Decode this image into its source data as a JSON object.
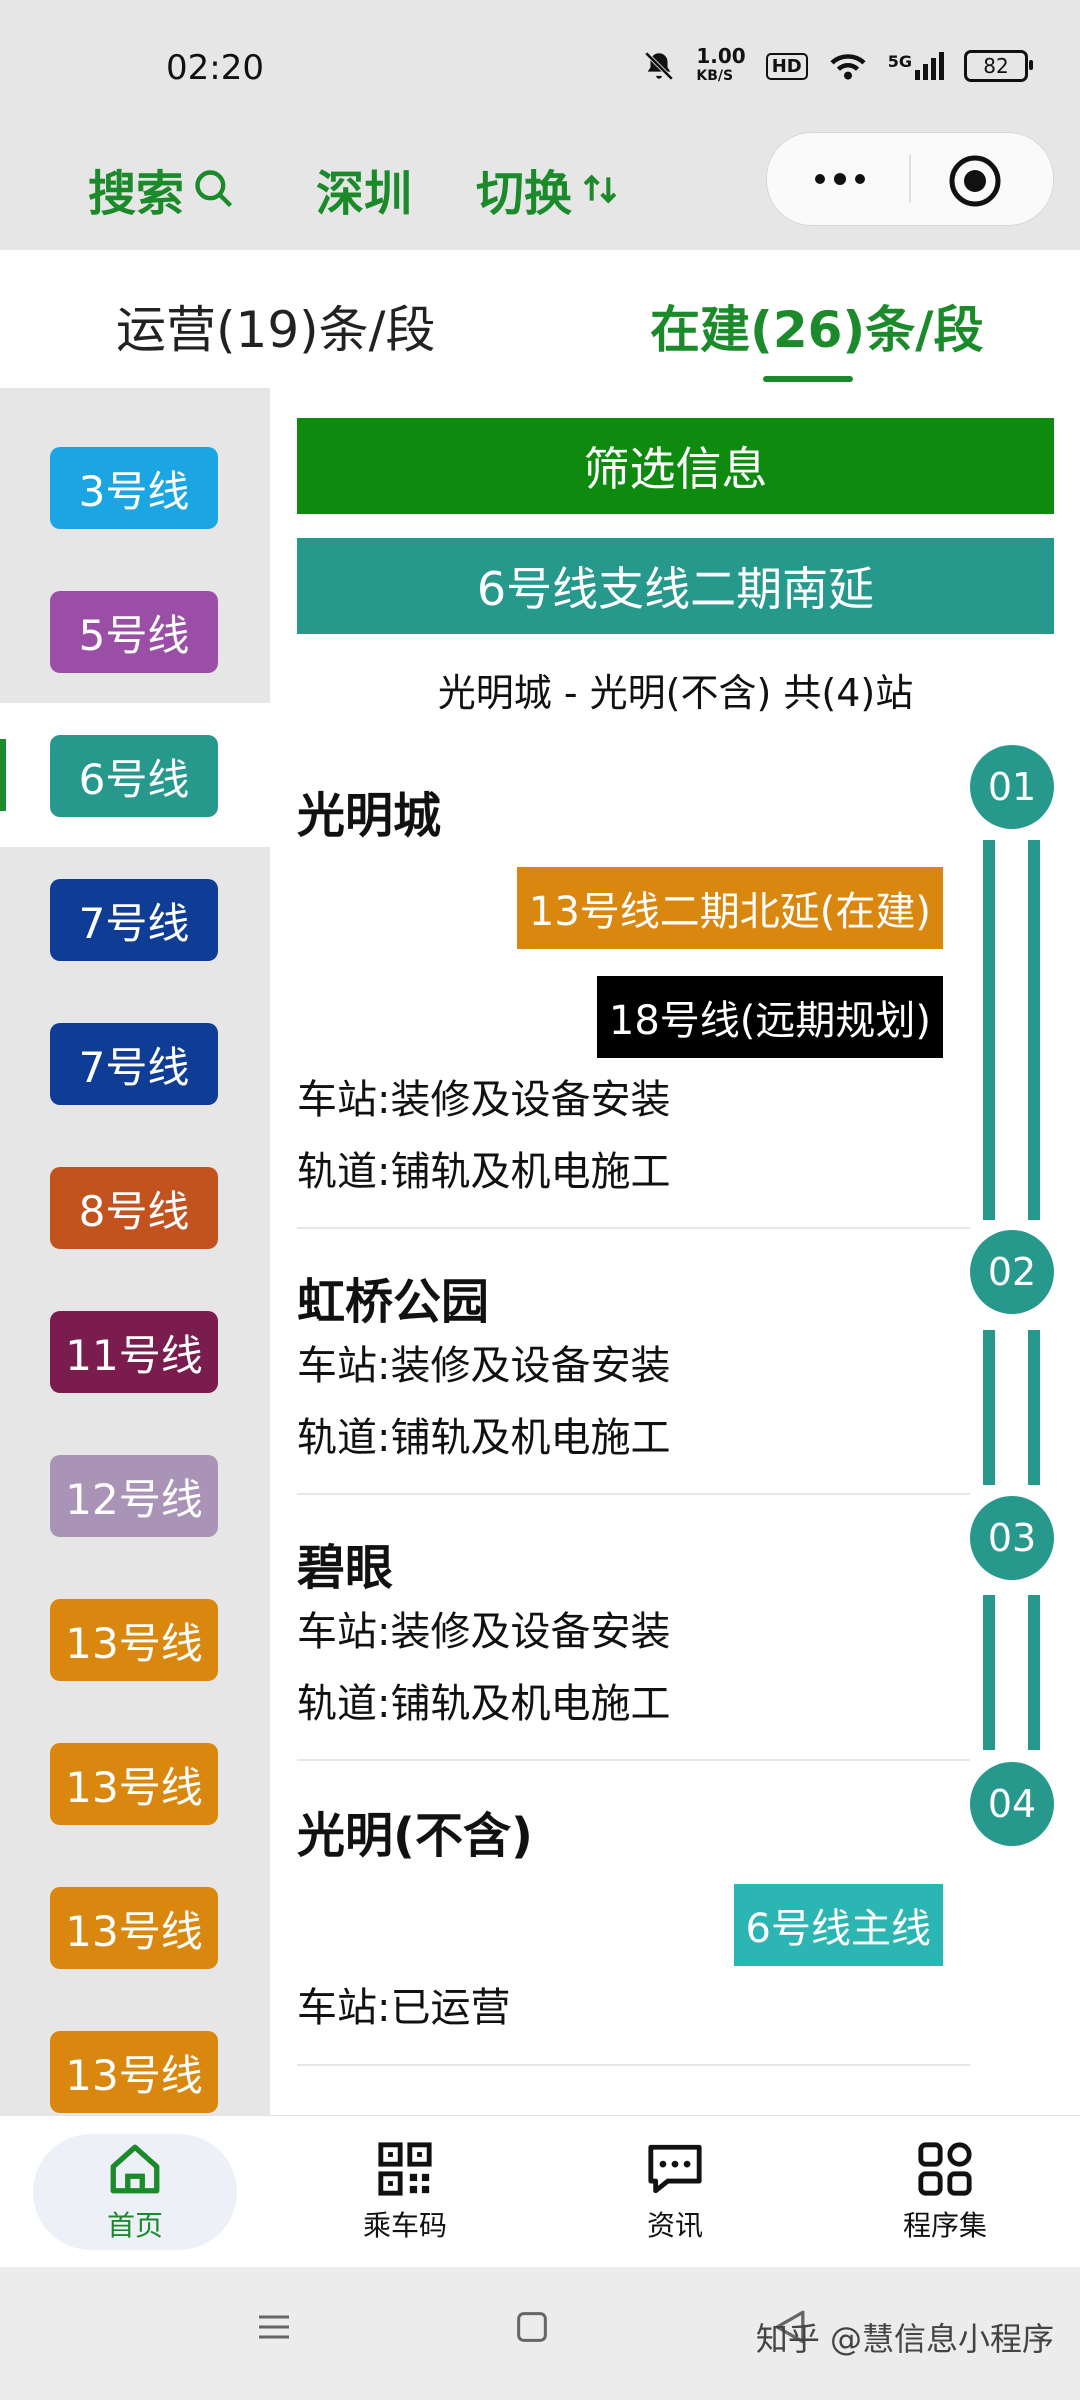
{
  "status_bar": {
    "time": "02:20",
    "speed_value": "1.00",
    "speed_unit": "KB/S",
    "hd": "HD",
    "network": "5G",
    "battery": "82"
  },
  "nav": {
    "search_label": "搜索",
    "city": "深圳",
    "switch_label": "切换"
  },
  "tabs": [
    {
      "label": "运营(19)条/段",
      "active": false
    },
    {
      "label": "在建(26)条/段",
      "active": true
    }
  ],
  "sidebar": {
    "items": [
      {
        "label": "3号线",
        "color": "#1ba6e3"
      },
      {
        "label": "5号线",
        "color": "#9b4ea6"
      },
      {
        "label": "6号线",
        "color": "#26998c"
      },
      {
        "label": "7号线",
        "color": "#0f3d96"
      },
      {
        "label": "7号线",
        "color": "#0f3d96"
      },
      {
        "label": "8号线",
        "color": "#c2531f"
      },
      {
        "label": "11号线",
        "color": "#7a1c4d"
      },
      {
        "label": "12号线",
        "color": "#a994b8"
      },
      {
        "label": "13号线",
        "color": "#d9870e"
      },
      {
        "label": "13号线",
        "color": "#d9870e"
      },
      {
        "label": "13号线",
        "color": "#d9870e"
      },
      {
        "label": "13号线",
        "color": "#d9870e"
      }
    ]
  },
  "main": {
    "filter_label": "筛选信息",
    "line_title": "6号线支线二期南延",
    "route_summary": "光明城 - 光明(不含) 共(4)站",
    "stations": [
      {
        "number": "01",
        "name": "光明城",
        "transfers": [
          {
            "label": "13号线二期北延(在建)",
            "color": "#d9870e"
          },
          {
            "label": "18号线(远期规划)",
            "color": "#000000"
          }
        ],
        "progress": [
          "车站:装修及设备安装",
          "轨道:铺轨及机电施工"
        ]
      },
      {
        "number": "02",
        "name": "虹桥公园",
        "transfers": [],
        "progress": [
          "车站:装修及设备安装",
          "轨道:铺轨及机电施工"
        ]
      },
      {
        "number": "03",
        "name": "碧眼",
        "transfers": [],
        "progress": [
          "车站:装修及设备安装",
          "轨道:铺轨及机电施工"
        ]
      },
      {
        "number": "04",
        "name": "光明(不含)",
        "transfers": [
          {
            "label": "6号线主线",
            "color": "#2bb5b3"
          }
        ],
        "progress": [
          "车站:已运营"
        ]
      }
    ]
  },
  "bottom_tabs": [
    {
      "label": "首页",
      "icon": "home-icon",
      "active": true
    },
    {
      "label": "乘车码",
      "icon": "qr-code-icon",
      "active": false
    },
    {
      "label": "资讯",
      "icon": "message-icon",
      "active": false
    },
    {
      "label": "程序集",
      "icon": "grid-apps-icon",
      "active": false
    }
  ],
  "watermark": "知乎 @慧信息小程序",
  "colors": {
    "accent_green": "#1a8a2a",
    "filter_green": "#0e8a0e",
    "line6_teal": "#26998c"
  }
}
